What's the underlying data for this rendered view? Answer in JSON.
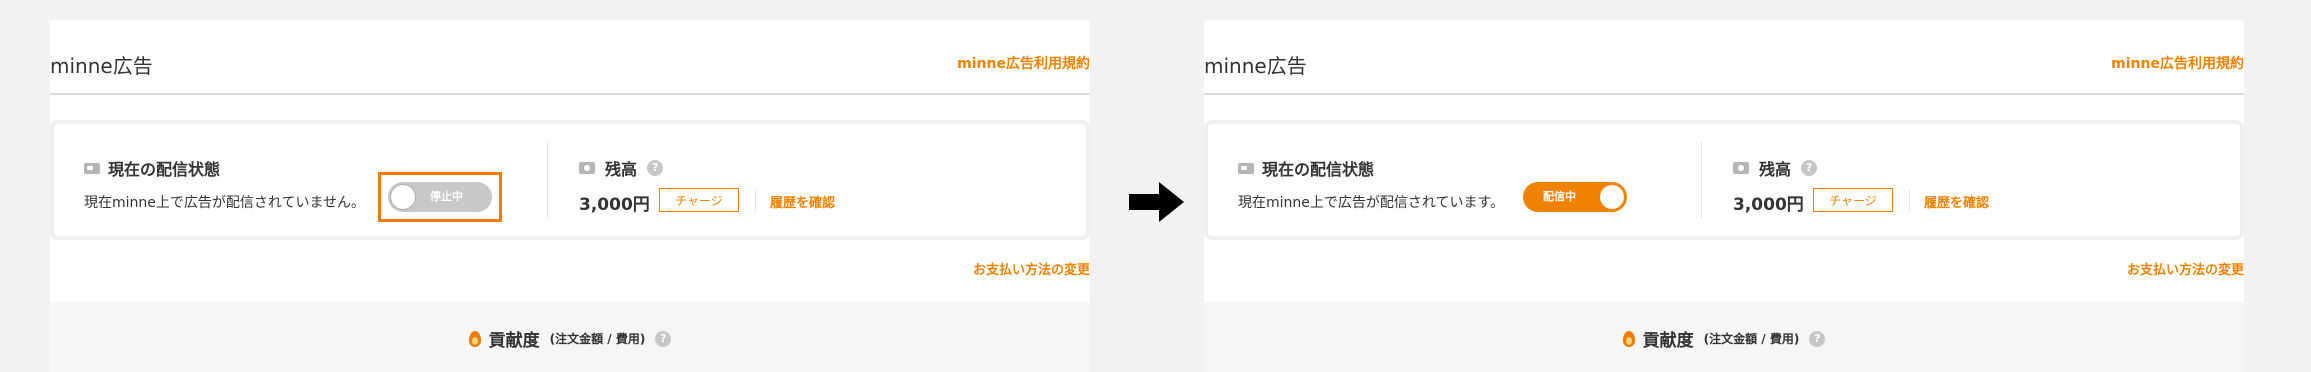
{
  "panels": {
    "before": {
      "title": "minne広告",
      "terms_link": "minne広告利用規約",
      "status_title": "現在の配信状態",
      "status_text": "現在minne上で広告が配信されていません。",
      "toggle_label": "停止中",
      "balance_title": "残高",
      "help": "?",
      "balance_amount": "3,000円",
      "charge_label": "チャージ",
      "history_link": "履歴を確認",
      "payment_link": "お支払い方法の変更",
      "contribution_title": "貢献度",
      "contribution_sub": "(注文金額 / 費用)"
    },
    "after": {
      "title": "minne広告",
      "terms_link": "minne広告利用規約",
      "status_title": "現在の配信状態",
      "status_text": "現在minne上で広告が配信されています。",
      "toggle_label": "配信中",
      "balance_title": "残高",
      "help": "?",
      "balance_amount": "3,000円",
      "charge_label": "チャージ",
      "history_link": "履歴を確認",
      "payment_link": "お支払い方法の変更",
      "contribution_title": "貢献度",
      "contribution_sub": "(注文金額 / 費用)"
    }
  },
  "colors": {
    "accent": "#ef8200",
    "toggle_off": "#c8c8c8",
    "highlight_border": "#ef7d00",
    "page_background": "#f3f2f0"
  },
  "icons": {
    "arrow": "right-arrow-icon",
    "status": "monitor-icon",
    "balance": "money-icon",
    "contribution": "flame-icon",
    "help": "help-icon"
  }
}
